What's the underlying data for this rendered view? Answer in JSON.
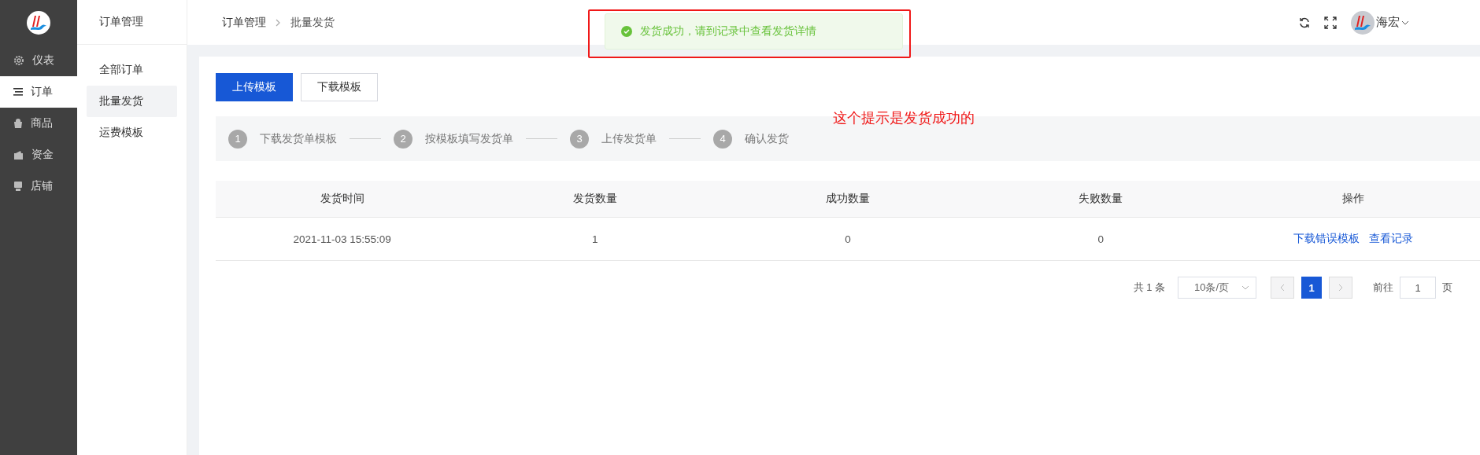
{
  "sidebar": {
    "items": [
      {
        "label": "仪表",
        "selected": false,
        "kind": "gear"
      },
      {
        "label": "订单",
        "selected": true,
        "kind": "list"
      },
      {
        "label": "商品",
        "selected": false,
        "kind": "bag"
      },
      {
        "label": "资金",
        "selected": false,
        "kind": "wallet"
      },
      {
        "label": "店铺",
        "selected": false,
        "kind": "store"
      }
    ]
  },
  "submenu": {
    "title": "订单管理",
    "items": [
      {
        "label": "全部订单",
        "selected": false
      },
      {
        "label": "批量发货",
        "selected": true
      },
      {
        "label": "运费模板",
        "selected": false
      }
    ]
  },
  "breadcrumb": [
    "订单管理",
    "批量发货"
  ],
  "user": {
    "name": "海宏"
  },
  "toast": {
    "kind": "success",
    "message": "发货成功，请到记录中查看发货详情"
  },
  "annotation": {
    "text": "这个提示是发货成功的"
  },
  "buttons": [
    {
      "label": "上传模板",
      "kind": "primary"
    },
    {
      "label": "下载模板",
      "kind": "default"
    }
  ],
  "steps": [
    {
      "number": "1",
      "label": "下载发货单模板"
    },
    {
      "number": "2",
      "label": "按模板填写发货单"
    },
    {
      "number": "3",
      "label": "上传发货单"
    },
    {
      "number": "4",
      "label": "确认发货"
    }
  ],
  "table": {
    "columns": [
      "发货时间",
      "发货数量",
      "成功数量",
      "失败数量",
      "操作"
    ],
    "rows": [
      {
        "cells": [
          "2021-11-03 15:55:09",
          "1",
          "0",
          "0"
        ],
        "actions": [
          "下载错误模板",
          "查看记录"
        ]
      }
    ]
  },
  "pagination": {
    "total": "共 1 条",
    "page_size": "10条/页",
    "pages": [
      {
        "label": "1",
        "selected": true
      }
    ],
    "goto_label": "前往",
    "goto_value": "1",
    "page_suffix": "页"
  }
}
